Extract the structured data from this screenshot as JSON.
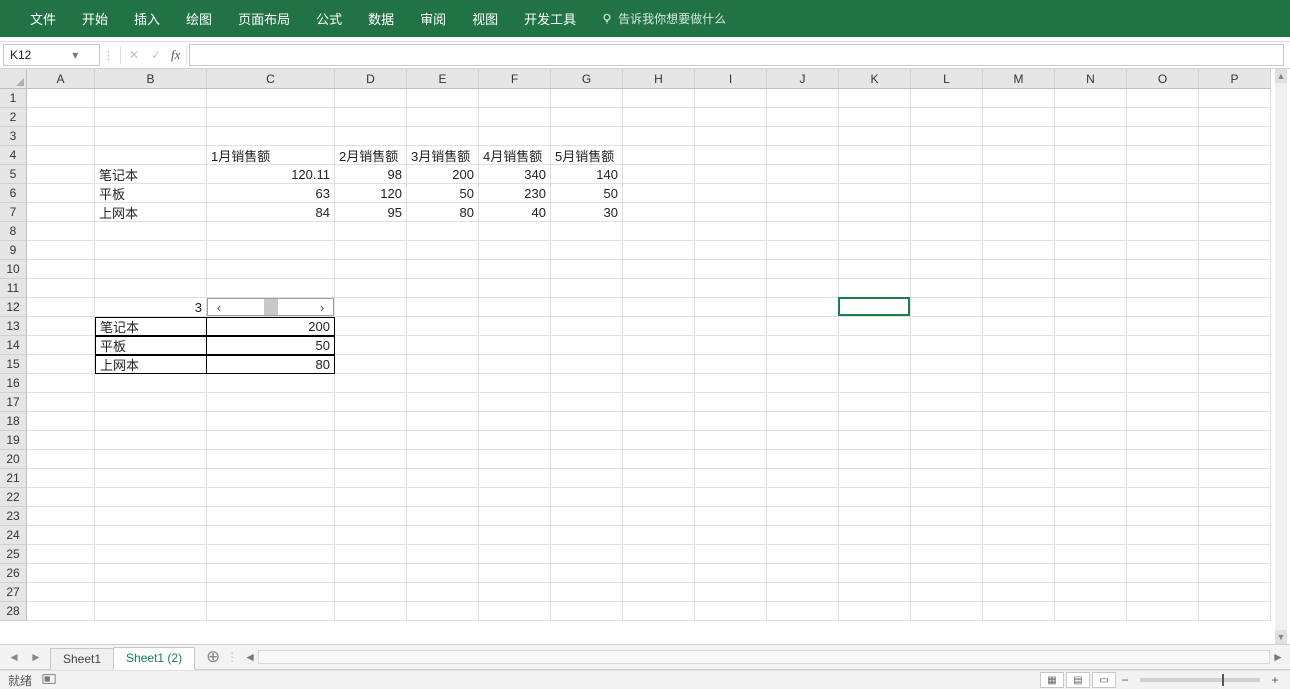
{
  "ribbon": {
    "tabs": [
      "文件",
      "开始",
      "插入",
      "绘图",
      "页面布局",
      "公式",
      "数据",
      "审阅",
      "视图",
      "开发工具"
    ],
    "tellme": "告诉我你想要做什么"
  },
  "formulaBar": {
    "nameBox": "K12",
    "cancel": "✕",
    "enter": "✓",
    "fx": "fx",
    "formula": ""
  },
  "grid": {
    "cols": [
      {
        "l": "A",
        "w": 68
      },
      {
        "l": "B",
        "w": 112
      },
      {
        "l": "C",
        "w": 128
      },
      {
        "l": "D",
        "w": 72
      },
      {
        "l": "E",
        "w": 72
      },
      {
        "l": "F",
        "w": 72
      },
      {
        "l": "G",
        "w": 72
      },
      {
        "l": "H",
        "w": 72
      },
      {
        "l": "I",
        "w": 72
      },
      {
        "l": "J",
        "w": 72
      },
      {
        "l": "K",
        "w": 72
      },
      {
        "l": "L",
        "w": 72
      },
      {
        "l": "M",
        "w": 72
      },
      {
        "l": "N",
        "w": 72
      },
      {
        "l": "O",
        "w": 72
      },
      {
        "l": "P",
        "w": 72
      }
    ],
    "rowCount": 28,
    "activeCell": "K12",
    "cells": {
      "r4": {
        "C": "1月销售额",
        "D": "2月销售额",
        "E": "3月销售额",
        "F": "4月销售额",
        "G": "5月销售额"
      },
      "r5": {
        "B": "笔记本",
        "C": "120.11",
        "D": "98",
        "E": "200",
        "F": "340",
        "G": "140"
      },
      "r6": {
        "B": "平板",
        "C": "63",
        "D": "120",
        "E": "50",
        "F": "230",
        "G": "50"
      },
      "r7": {
        "B": "上网本",
        "C": "84",
        "D": "95",
        "E": "80",
        "F": "40",
        "G": "30"
      },
      "r12": {
        "B": "3"
      },
      "r13": {
        "B": "笔记本",
        "C": "200"
      },
      "r14": {
        "B": "平板",
        "C": "50"
      },
      "r15": {
        "B": "上网本",
        "C": "80"
      }
    }
  },
  "sheetTabs": {
    "tabs": [
      "Sheet1",
      "Sheet1 (2)"
    ],
    "activeIndex": 1
  },
  "status": {
    "ready": "就绪"
  }
}
